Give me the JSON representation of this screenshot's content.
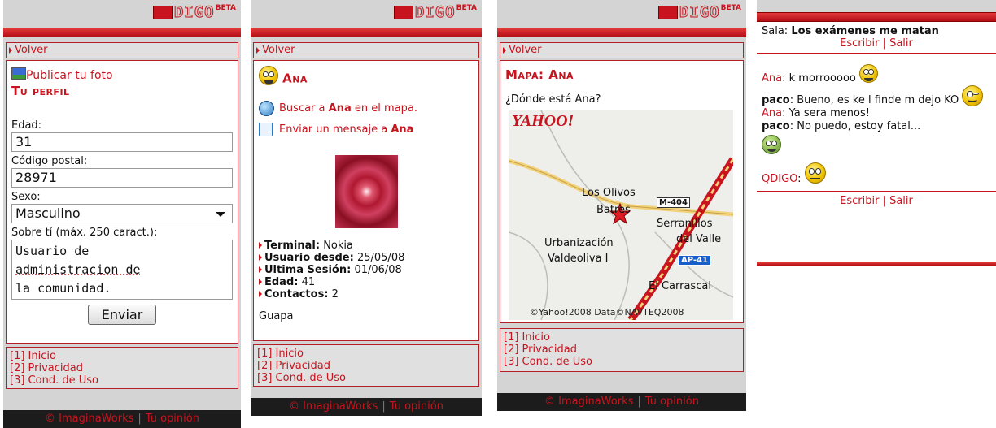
{
  "logo": {
    "text": "DIGO",
    "beta": "BETA"
  },
  "nav": {
    "back": "Volver"
  },
  "footer_links": [
    "[1] Inicio",
    "[2] Privacidad",
    "[3] Cond. de Uso"
  ],
  "bottom_bar": {
    "company": "© ImaginaWorks",
    "feedback": "Tu opinión"
  },
  "screen1": {
    "publish_photo": "Publicar tu foto",
    "title": "Tu perfil",
    "age_label": "Edad:",
    "age_value": "31",
    "zip_label": "Código postal:",
    "zip_value": "28971",
    "sex_label": "Sexo:",
    "sex_value": "Masculino",
    "about_label": "Sobre tí (máx. 250 caract.):",
    "about_line1": "Usuario de",
    "about_line2": "administracion de",
    "about_line3": "la comunidad.",
    "submit": "Enviar"
  },
  "screen2": {
    "title": "Ana",
    "map_pre": "Buscar a",
    "map_name": "Ana",
    "map_post": "en el mapa.",
    "msg_pre": "Enviar un mensaje a",
    "msg_name": "Ana",
    "details": [
      {
        "label": "Terminal:",
        "value": "Nokia"
      },
      {
        "label": "Usuario desde:",
        "value": "25/05/08"
      },
      {
        "label": "Ultima Sesión:",
        "value": "01/06/08"
      },
      {
        "label": "Edad:",
        "value": "41"
      },
      {
        "label": "Contactos:",
        "value": "2"
      }
    ],
    "status": "Guapa"
  },
  "screen3": {
    "title": "Mapa: Ana",
    "question": "¿Dónde está Ana?",
    "map": {
      "brand": "YAHOO!",
      "places": [
        "Los Olivos",
        "Batres",
        "Urbanización",
        "Valdeoliva I",
        "Serranillos",
        "del Valle",
        "El Carrascal"
      ],
      "roads": [
        "M-404",
        "AP-41"
      ],
      "copyright": "©Yahoo!2008 Data©NAVTEQ2008"
    }
  },
  "screen4": {
    "room_label": "Sala:",
    "room_name": "Los exámenes me matan",
    "write": "Escribir",
    "leave": "Salir",
    "messages": [
      {
        "name": "Ana",
        "name_bold": false,
        "text": "k morrooooo"
      },
      {
        "name": "paco",
        "name_bold": true,
        "text": "Bueno, es ke l finde m dejo KO"
      },
      {
        "name": "Ana",
        "name_bold": false,
        "text": "Ya sera menos!"
      },
      {
        "name": "paco",
        "name_bold": true,
        "text": "No puedo, estoy fatal..."
      },
      {
        "name": "QDIGO",
        "name_bold": false,
        "text": ""
      }
    ]
  },
  "colors": {
    "accent": "#c8141e",
    "panel_bg": "#e0e0e0",
    "dark_footer": "#1c1c1c"
  }
}
